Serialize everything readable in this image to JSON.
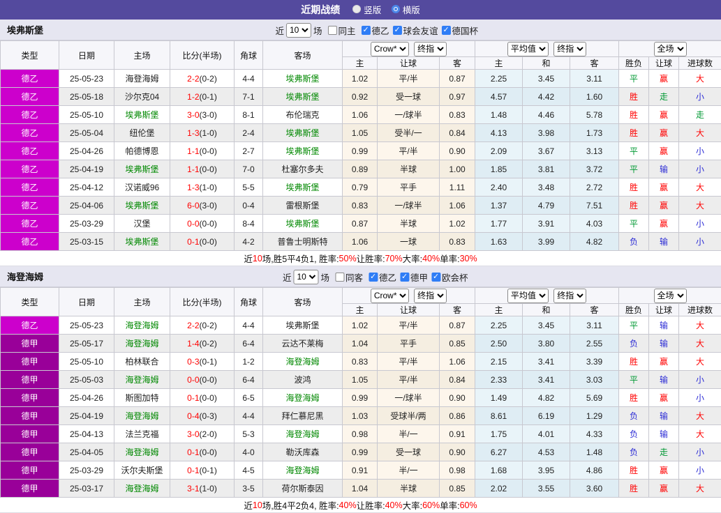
{
  "titlebar": {
    "title": "近期战绩",
    "radios": [
      {
        "label": "竖版",
        "checked": false
      },
      {
        "label": "横版",
        "checked": true
      }
    ]
  },
  "league_colors": {
    "德乙": "#cc00cc",
    "德甲": "#990099"
  },
  "table_header": {
    "cols": [
      "类型",
      "日期",
      "主场",
      "比分(半场)",
      "角球",
      "客场"
    ],
    "sub": [
      "主",
      "让球",
      "客",
      "主",
      "和",
      "客",
      "胜负",
      "让球",
      "进球数"
    ],
    "bookmaker": "Crow*",
    "stage1": "终指",
    "average": "平均值",
    "stage2": "终指",
    "scope": "全场"
  },
  "sections": [
    {
      "team": "埃弗斯堡",
      "filter": {
        "near": "近",
        "games": "10",
        "games_suffix": "场",
        "same": {
          "label": "同主",
          "checked": false
        },
        "leagues": [
          {
            "label": "德乙",
            "checked": true
          },
          {
            "label": "球会友谊",
            "checked": true
          },
          {
            "label": "德国杯",
            "checked": true
          }
        ]
      },
      "rows": [
        {
          "league": "德乙",
          "date": "25-05-23",
          "home": "海登海姆",
          "hh": false,
          "score": "2-2",
          "half": "(0-2)",
          "corner": "4-4",
          "away": "埃弗斯堡",
          "ah": true,
          "o1": [
            "1.02",
            "平/半",
            "0.87"
          ],
          "o2": [
            "2.25",
            "3.45",
            "3.11"
          ],
          "res": [
            {
              "t": "平",
              "c": "g"
            },
            {
              "t": "赢",
              "c": "r"
            },
            {
              "t": "大",
              "c": "r"
            }
          ]
        },
        {
          "league": "德乙",
          "date": "25-05-18",
          "home": "沙尔克04",
          "hh": false,
          "score": "1-2",
          "half": "(0-1)",
          "corner": "7-1",
          "away": "埃弗斯堡",
          "ah": true,
          "o1": [
            "0.92",
            "受一球",
            "0.97"
          ],
          "o2": [
            "4.57",
            "4.42",
            "1.60"
          ],
          "res": [
            {
              "t": "胜",
              "c": "r"
            },
            {
              "t": "走",
              "c": "g"
            },
            {
              "t": "小",
              "c": "b"
            }
          ]
        },
        {
          "league": "德乙",
          "date": "25-05-10",
          "home": "埃弗斯堡",
          "hh": true,
          "score": "3-0",
          "half": "(3-0)",
          "corner": "8-1",
          "away": "布伦瑞克",
          "ah": false,
          "o1": [
            "1.06",
            "一/球半",
            "0.83"
          ],
          "o2": [
            "1.48",
            "4.46",
            "5.78"
          ],
          "res": [
            {
              "t": "胜",
              "c": "r"
            },
            {
              "t": "赢",
              "c": "r"
            },
            {
              "t": "走",
              "c": "g"
            }
          ]
        },
        {
          "league": "德乙",
          "date": "25-05-04",
          "home": "纽伦堡",
          "hh": false,
          "score": "1-3",
          "half": "(1-0)",
          "corner": "2-4",
          "away": "埃弗斯堡",
          "ah": true,
          "o1": [
            "1.05",
            "受半/一",
            "0.84"
          ],
          "o2": [
            "4.13",
            "3.98",
            "1.73"
          ],
          "res": [
            {
              "t": "胜",
              "c": "r"
            },
            {
              "t": "赢",
              "c": "r"
            },
            {
              "t": "大",
              "c": "r"
            }
          ]
        },
        {
          "league": "德乙",
          "date": "25-04-26",
          "home": "帕德博恩",
          "hh": false,
          "score": "1-1",
          "half": "(0-0)",
          "corner": "2-7",
          "away": "埃弗斯堡",
          "ah": true,
          "o1": [
            "0.99",
            "平/半",
            "0.90"
          ],
          "o2": [
            "2.09",
            "3.67",
            "3.13"
          ],
          "res": [
            {
              "t": "平",
              "c": "g"
            },
            {
              "t": "赢",
              "c": "r"
            },
            {
              "t": "小",
              "c": "b"
            }
          ]
        },
        {
          "league": "德乙",
          "date": "25-04-19",
          "home": "埃弗斯堡",
          "hh": true,
          "score": "1-1",
          "half": "(0-0)",
          "corner": "7-0",
          "away": "杜塞尔多夫",
          "ah": false,
          "o1": [
            "0.89",
            "半球",
            "1.00"
          ],
          "o2": [
            "1.85",
            "3.81",
            "3.72"
          ],
          "res": [
            {
              "t": "平",
              "c": "g"
            },
            {
              "t": "输",
              "c": "b"
            },
            {
              "t": "小",
              "c": "b"
            }
          ]
        },
        {
          "league": "德乙",
          "date": "25-04-12",
          "home": "汉诺威96",
          "hh": false,
          "score": "1-3",
          "half": "(1-0)",
          "corner": "5-5",
          "away": "埃弗斯堡",
          "ah": true,
          "o1": [
            "0.79",
            "平手",
            "1.11"
          ],
          "o2": [
            "2.40",
            "3.48",
            "2.72"
          ],
          "res": [
            {
              "t": "胜",
              "c": "r"
            },
            {
              "t": "赢",
              "c": "r"
            },
            {
              "t": "大",
              "c": "r"
            }
          ]
        },
        {
          "league": "德乙",
          "date": "25-04-06",
          "home": "埃弗斯堡",
          "hh": true,
          "score": "6-0",
          "half": "(3-0)",
          "corner": "0-4",
          "away": "雷根斯堡",
          "ah": false,
          "o1": [
            "0.83",
            "一/球半",
            "1.06"
          ],
          "o2": [
            "1.37",
            "4.79",
            "7.51"
          ],
          "res": [
            {
              "t": "胜",
              "c": "r"
            },
            {
              "t": "赢",
              "c": "r"
            },
            {
              "t": "大",
              "c": "r"
            }
          ]
        },
        {
          "league": "德乙",
          "date": "25-03-29",
          "home": "汉堡",
          "hh": false,
          "score": "0-0",
          "half": "(0-0)",
          "corner": "8-4",
          "away": "埃弗斯堡",
          "ah": true,
          "o1": [
            "0.87",
            "半球",
            "1.02"
          ],
          "o2": [
            "1.77",
            "3.91",
            "4.03"
          ],
          "res": [
            {
              "t": "平",
              "c": "g"
            },
            {
              "t": "赢",
              "c": "r"
            },
            {
              "t": "小",
              "c": "b"
            }
          ]
        },
        {
          "league": "德乙",
          "date": "25-03-15",
          "home": "埃弗斯堡",
          "hh": true,
          "score": "0-1",
          "half": "(0-0)",
          "corner": "4-2",
          "away": "普鲁士明斯特",
          "ah": false,
          "o1": [
            "1.06",
            "一球",
            "0.83"
          ],
          "o2": [
            "1.63",
            "3.99",
            "4.82"
          ],
          "res": [
            {
              "t": "负",
              "c": "b"
            },
            {
              "t": "输",
              "c": "b"
            },
            {
              "t": "小",
              "c": "b"
            }
          ]
        }
      ],
      "summary": [
        {
          "t": "近",
          "c": "k"
        },
        {
          "t": "10",
          "c": "r"
        },
        {
          "t": "场,胜5平4负1, 胜率:",
          "c": "k"
        },
        {
          "t": "50%",
          "c": "r"
        },
        {
          "t": " 让胜率:",
          "c": "k"
        },
        {
          "t": "70%",
          "c": "r"
        },
        {
          "t": " 大率:",
          "c": "k"
        },
        {
          "t": "40%",
          "c": "r"
        },
        {
          "t": " 单率:",
          "c": "k"
        },
        {
          "t": "30%",
          "c": "r"
        }
      ]
    },
    {
      "team": "海登海姆",
      "filter": {
        "near": "近",
        "games": "10",
        "games_suffix": "场",
        "same": {
          "label": "同客",
          "checked": false
        },
        "leagues": [
          {
            "label": "德乙",
            "checked": true
          },
          {
            "label": "德甲",
            "checked": true
          },
          {
            "label": "欧会杯",
            "checked": true
          }
        ]
      },
      "rows": [
        {
          "league": "德乙",
          "date": "25-05-23",
          "home": "海登海姆",
          "hh": true,
          "score": "2-2",
          "half": "(0-2)",
          "corner": "4-4",
          "away": "埃弗斯堡",
          "ah": false,
          "o1": [
            "1.02",
            "平/半",
            "0.87"
          ],
          "o2": [
            "2.25",
            "3.45",
            "3.11"
          ],
          "res": [
            {
              "t": "平",
              "c": "g"
            },
            {
              "t": "输",
              "c": "b"
            },
            {
              "t": "大",
              "c": "r"
            }
          ]
        },
        {
          "league": "德甲",
          "date": "25-05-17",
          "home": "海登海姆",
          "hh": true,
          "score": "1-4",
          "half": "(0-2)",
          "corner": "6-4",
          "away": "云达不莱梅",
          "ah": false,
          "o1": [
            "1.04",
            "平手",
            "0.85"
          ],
          "o2": [
            "2.50",
            "3.80",
            "2.55"
          ],
          "res": [
            {
              "t": "负",
              "c": "b"
            },
            {
              "t": "输",
              "c": "b"
            },
            {
              "t": "大",
              "c": "r"
            }
          ]
        },
        {
          "league": "德甲",
          "date": "25-05-10",
          "home": "柏林联合",
          "hh": false,
          "score": "0-3",
          "half": "(0-1)",
          "corner": "1-2",
          "away": "海登海姆",
          "ah": true,
          "o1": [
            "0.83",
            "平/半",
            "1.06"
          ],
          "o2": [
            "2.15",
            "3.41",
            "3.39"
          ],
          "res": [
            {
              "t": "胜",
              "c": "r"
            },
            {
              "t": "赢",
              "c": "r"
            },
            {
              "t": "大",
              "c": "r"
            }
          ]
        },
        {
          "league": "德甲",
          "date": "25-05-03",
          "home": "海登海姆",
          "hh": true,
          "score": "0-0",
          "half": "(0-0)",
          "corner": "6-4",
          "away": "波鸿",
          "ah": false,
          "o1": [
            "1.05",
            "平/半",
            "0.84"
          ],
          "o2": [
            "2.33",
            "3.41",
            "3.03"
          ],
          "res": [
            {
              "t": "平",
              "c": "g"
            },
            {
              "t": "输",
              "c": "b"
            },
            {
              "t": "小",
              "c": "b"
            }
          ]
        },
        {
          "league": "德甲",
          "date": "25-04-26",
          "home": "斯图加特",
          "hh": false,
          "score": "0-1",
          "half": "(0-0)",
          "corner": "6-5",
          "away": "海登海姆",
          "ah": true,
          "o1": [
            "0.99",
            "一/球半",
            "0.90"
          ],
          "o2": [
            "1.49",
            "4.82",
            "5.69"
          ],
          "res": [
            {
              "t": "胜",
              "c": "r"
            },
            {
              "t": "赢",
              "c": "r"
            },
            {
              "t": "小",
              "c": "b"
            }
          ]
        },
        {
          "league": "德甲",
          "date": "25-04-19",
          "home": "海登海姆",
          "hh": true,
          "score": "0-4",
          "half": "(0-3)",
          "corner": "4-4",
          "away": "拜仁慕尼黑",
          "ah": false,
          "o1": [
            "1.03",
            "受球半/两",
            "0.86"
          ],
          "o2": [
            "8.61",
            "6.19",
            "1.29"
          ],
          "res": [
            {
              "t": "负",
              "c": "b"
            },
            {
              "t": "输",
              "c": "b"
            },
            {
              "t": "大",
              "c": "r"
            }
          ]
        },
        {
          "league": "德甲",
          "date": "25-04-13",
          "home": "法兰克福",
          "hh": false,
          "score": "3-0",
          "half": "(2-0)",
          "corner": "5-3",
          "away": "海登海姆",
          "ah": true,
          "o1": [
            "0.98",
            "半/一",
            "0.91"
          ],
          "o2": [
            "1.75",
            "4.01",
            "4.33"
          ],
          "res": [
            {
              "t": "负",
              "c": "b"
            },
            {
              "t": "输",
              "c": "b"
            },
            {
              "t": "大",
              "c": "r"
            }
          ]
        },
        {
          "league": "德甲",
          "date": "25-04-05",
          "home": "海登海姆",
          "hh": true,
          "score": "0-1",
          "half": "(0-0)",
          "corner": "4-0",
          "away": "勒沃库森",
          "ah": false,
          "o1": [
            "0.99",
            "受一球",
            "0.90"
          ],
          "o2": [
            "6.27",
            "4.53",
            "1.48"
          ],
          "res": [
            {
              "t": "负",
              "c": "b"
            },
            {
              "t": "走",
              "c": "g"
            },
            {
              "t": "小",
              "c": "b"
            }
          ]
        },
        {
          "league": "德甲",
          "date": "25-03-29",
          "home": "沃尔夫斯堡",
          "hh": false,
          "score": "0-1",
          "half": "(0-1)",
          "corner": "4-5",
          "away": "海登海姆",
          "ah": true,
          "o1": [
            "0.91",
            "半/一",
            "0.98"
          ],
          "o2": [
            "1.68",
            "3.95",
            "4.86"
          ],
          "res": [
            {
              "t": "胜",
              "c": "r"
            },
            {
              "t": "赢",
              "c": "r"
            },
            {
              "t": "小",
              "c": "b"
            }
          ]
        },
        {
          "league": "德甲",
          "date": "25-03-17",
          "home": "海登海姆",
          "hh": true,
          "score": "3-1",
          "half": "(1-0)",
          "corner": "3-5",
          "away": "荷尔斯泰因",
          "ah": false,
          "o1": [
            "1.04",
            "半球",
            "0.85"
          ],
          "o2": [
            "2.02",
            "3.55",
            "3.60"
          ],
          "res": [
            {
              "t": "胜",
              "c": "r"
            },
            {
              "t": "赢",
              "c": "r"
            },
            {
              "t": "大",
              "c": "r"
            }
          ]
        }
      ],
      "summary": [
        {
          "t": "近",
          "c": "k"
        },
        {
          "t": "10",
          "c": "r"
        },
        {
          "t": "场,胜4平2负4, 胜率:",
          "c": "k"
        },
        {
          "t": "40%",
          "c": "r"
        },
        {
          "t": " 让胜率:",
          "c": "k"
        },
        {
          "t": "40%",
          "c": "r"
        },
        {
          "t": " 大率:",
          "c": "k"
        },
        {
          "t": "60%",
          "c": "r"
        },
        {
          "t": " 单率:",
          "c": "k"
        },
        {
          "t": "60%",
          "c": "r"
        }
      ]
    }
  ]
}
